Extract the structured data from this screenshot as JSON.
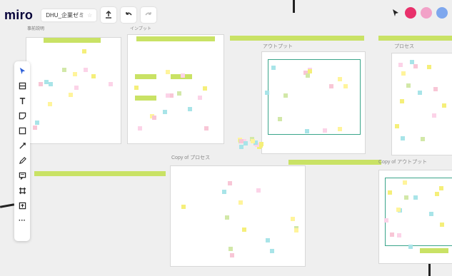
{
  "app": {
    "logo_text": "miro",
    "board_name": "DHU_企業ゼミ",
    "board_subtitle": "事前説明"
  },
  "toolbar_top": {
    "upload_icon": "upload-icon",
    "undo_icon": "undo-icon",
    "redo_icon": "redo-icon",
    "star_icon": "star-icon"
  },
  "frames": {
    "input_label": "インプット",
    "output_label": "アウトプット",
    "process_label": "プロセス",
    "copy_process_label": "Copy of プロセス",
    "copy_output_label": "Copy of アウトプット"
  },
  "avatars": [
    {
      "initials": "",
      "color": "#e8316b"
    },
    {
      "initials": "",
      "color": "#f2a2c8"
    },
    {
      "initials": "",
      "color": "#7ea7ee"
    }
  ],
  "left_tools": [
    {
      "name": "select-tool",
      "icon": "cursor-icon"
    },
    {
      "name": "templates-tool",
      "icon": "templates-icon"
    },
    {
      "name": "text-tool",
      "icon": "text-icon"
    },
    {
      "name": "sticky-note-tool",
      "icon": "sticky-note-icon"
    },
    {
      "name": "shape-tool",
      "icon": "shape-icon"
    },
    {
      "name": "connection-line-tool",
      "icon": "connector-icon"
    },
    {
      "name": "pen-tool",
      "icon": "pen-icon"
    },
    {
      "name": "comment-tool",
      "icon": "comment-icon"
    },
    {
      "name": "frame-tool",
      "icon": "frame-icon"
    },
    {
      "name": "upload-tool",
      "icon": "upload-icon"
    },
    {
      "name": "more-tool",
      "icon": "more-icon"
    }
  ],
  "more_label": "···"
}
